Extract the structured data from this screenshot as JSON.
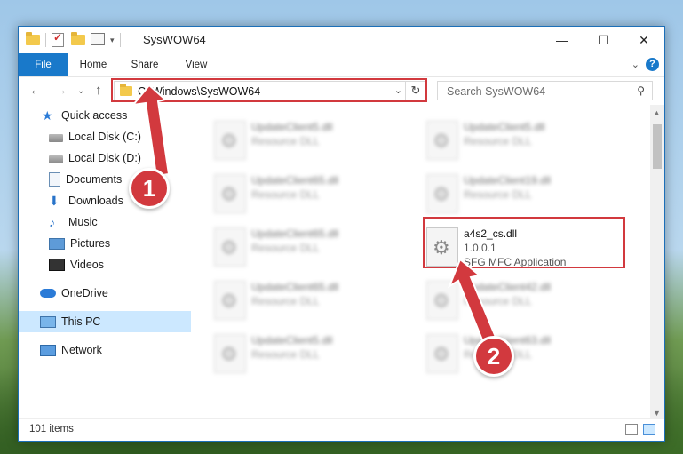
{
  "window": {
    "title": "SysWOW64"
  },
  "ribbon": {
    "tabs": [
      "File",
      "Home",
      "Share",
      "View"
    ],
    "help": "?"
  },
  "address": {
    "path": "C:\\Windows\\SysWOW64"
  },
  "search": {
    "placeholder": "Search SysWOW64"
  },
  "sidebar": {
    "items": [
      {
        "label": "Quick access",
        "icon": "star-icon"
      },
      {
        "label": "Local Disk (C:)",
        "icon": "drive-icon"
      },
      {
        "label": "Local Disk (D:)",
        "icon": "drive-icon"
      },
      {
        "label": "Documents",
        "icon": "documents-icon"
      },
      {
        "label": "Downloads",
        "icon": "download-icon"
      },
      {
        "label": "Music",
        "icon": "music-icon"
      },
      {
        "label": "Pictures",
        "icon": "pictures-icon"
      },
      {
        "label": "Videos",
        "icon": "videos-icon"
      },
      {
        "label": "OneDrive",
        "icon": "cloud-icon"
      },
      {
        "label": "This PC",
        "icon": "computer-icon"
      },
      {
        "label": "Network",
        "icon": "network-icon"
      }
    ]
  },
  "files": [
    {
      "name": "UpdateClient5.dll",
      "type": "Resource DLL"
    },
    {
      "name": "UpdateClient5.dll",
      "type": "Resource DLL"
    },
    {
      "name": "UpdateClient65.dll",
      "type": "Resource DLL"
    },
    {
      "name": "UpdateClient19.dll",
      "type": "Resource DLL"
    },
    {
      "name": "UpdateClient65.dll",
      "type": "Resource DLL"
    },
    {
      "name": "a4s2_cs.dll",
      "version": "1.0.0.1",
      "type": "SFG MFC Application"
    },
    {
      "name": "UpdateClient65.dll",
      "type": "Resource DLL"
    },
    {
      "name": "UpdateClient42.dll",
      "type": "Resource DLL"
    },
    {
      "name": "UpdateClient5.dll",
      "type": "Resource DLL"
    },
    {
      "name": "UpdateClient63.dll",
      "type": "Resource DLL"
    }
  ],
  "status": {
    "count": "101 items"
  },
  "callouts": [
    "1",
    "2"
  ],
  "colors": {
    "accent": "#1979ca",
    "highlight": "#d2393e",
    "selected": "#cce8ff"
  }
}
